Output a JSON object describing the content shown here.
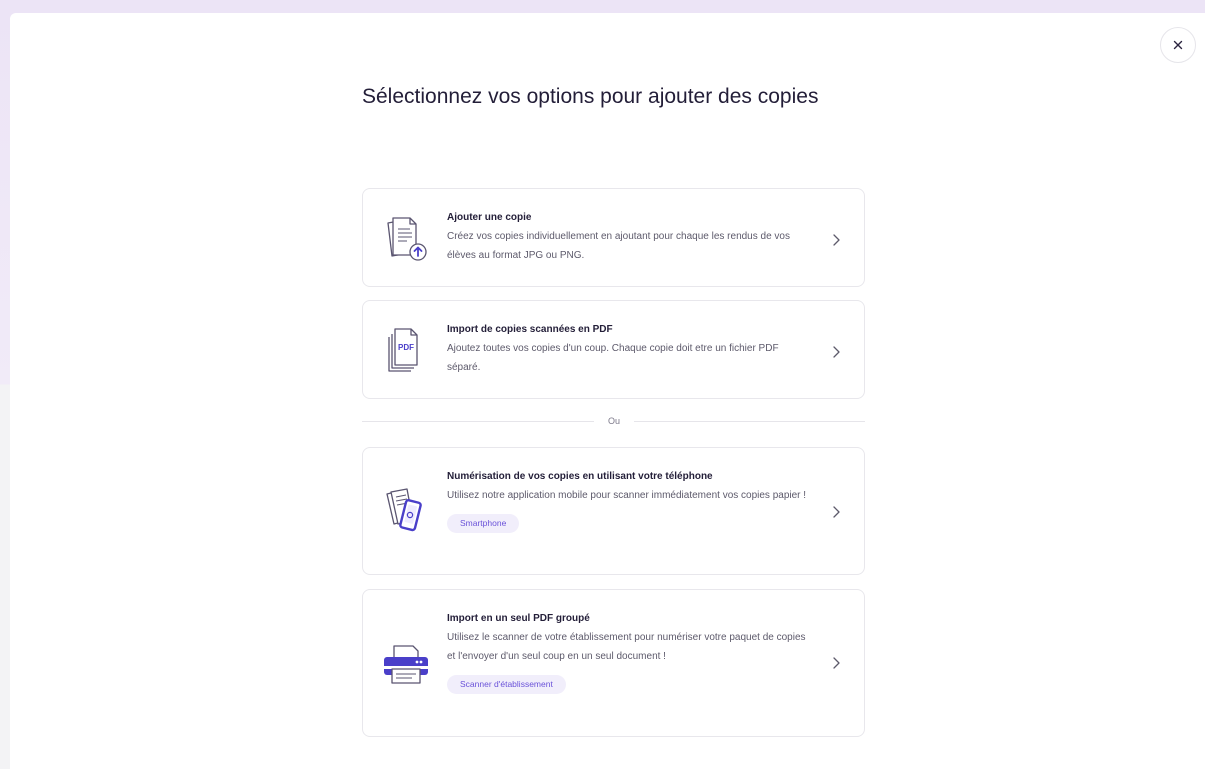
{
  "modal": {
    "title": "Sélectionnez vos options pour ajouter des copies",
    "close_icon": "close-icon",
    "separator_label": "Ou"
  },
  "options": [
    {
      "title": "Ajouter une copie",
      "description": "Créez vos copies individuellement en ajoutant pour chaque les rendus de vos élèves au format JPG ou PNG.",
      "icon": "document-upload-icon"
    },
    {
      "title": "Import de copies scannées en PDF",
      "description": "Ajoutez toutes vos copies d'un coup. Chaque copie doit etre un fichier PDF séparé.",
      "icon": "pdf-stack-icon",
      "icon_text": "PDF"
    },
    {
      "title": "Numérisation de vos copies en utilisant votre téléphone",
      "description": "Utilisez notre application mobile pour scanner immédiatement vos copies papier !",
      "tag": "Smartphone",
      "icon": "phone-scan-icon"
    },
    {
      "title": "Import en un seul PDF groupé",
      "description": "Utilisez le scanner de votre établissement pour numériser votre paquet de copies et l'envoyer d'un seul coup en un seul document !",
      "tag": "Scanner d'établissement",
      "icon": "printer-icon"
    }
  ],
  "colors": {
    "accent": "#6a52d9",
    "icon_stroke": "#5a5570",
    "tag_bg": "#f1eefb"
  }
}
